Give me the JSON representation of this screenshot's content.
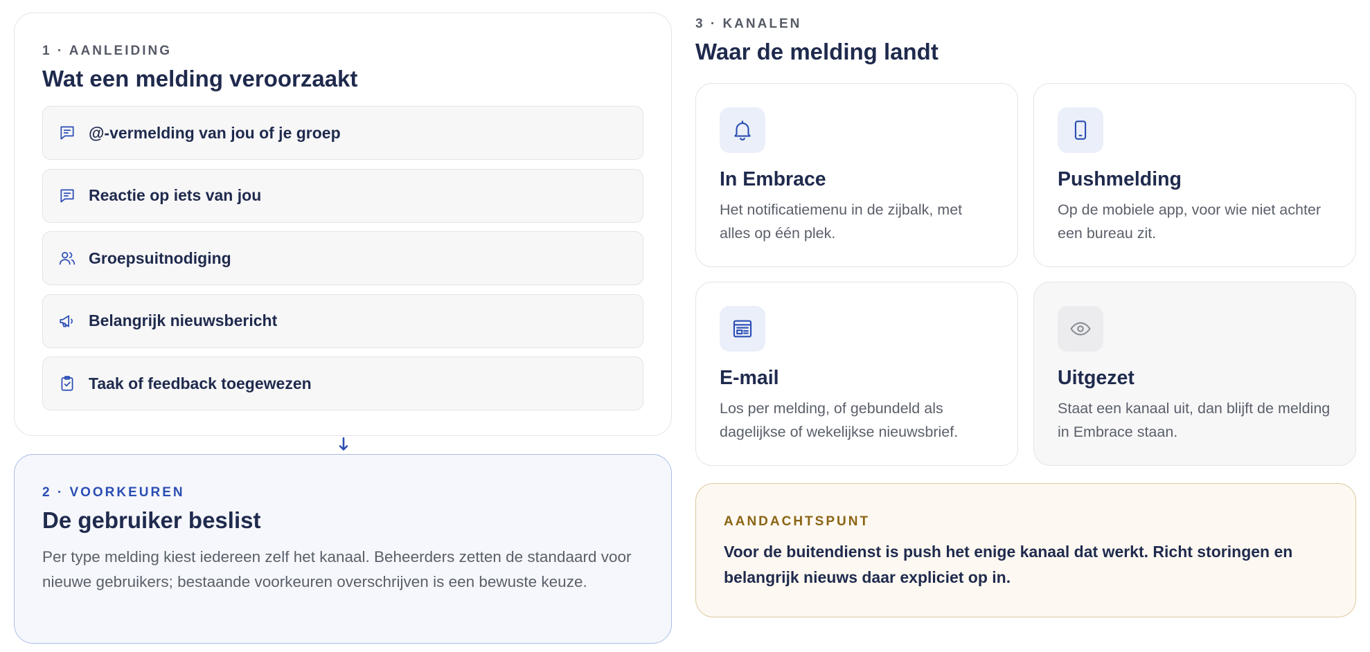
{
  "trigger": {
    "eyebrow": "1 · AANLEIDING",
    "title": "Wat een melding veroorzaakt",
    "items": [
      {
        "label": "@-vermelding van jou of je groep",
        "icon": "chat-icon"
      },
      {
        "label": "Reactie op iets van jou",
        "icon": "chat-icon"
      },
      {
        "label": "Groepsuitnodiging",
        "icon": "users-icon"
      },
      {
        "label": "Belangrijk nieuwsbericht",
        "icon": "megaphone-icon"
      },
      {
        "label": "Taak of feedback toegewezen",
        "icon": "clipboard-check-icon"
      }
    ]
  },
  "preferences": {
    "eyebrow": "2 · VOORKEUREN",
    "title": "De gebruiker beslist",
    "body": "Per type melding kiest iedereen zelf het kanaal. Beheerders zetten de standaard voor nieuwe gebruikers; bestaande voorkeuren overschrijven is een bewuste keuze."
  },
  "channels": {
    "eyebrow": "3 · KANALEN",
    "title": "Waar de melding landt",
    "items": [
      {
        "title": "In Embrace",
        "desc": "Het notificatiemenu in de zijbalk, met alles op één plek.",
        "icon": "bell-icon"
      },
      {
        "title": "Pushmelding",
        "desc": "Op de mobiele app, voor wie niet achter een bureau zit.",
        "icon": "phone-icon"
      },
      {
        "title": "E-mail",
        "desc": "Los per melding, of gebundeld als dagelijkse of wekelijkse nieuwsbrief.",
        "icon": "newsletter-icon"
      },
      {
        "title": "Uitgezet",
        "desc": "Staat een kanaal uit, dan blijft de melding in Embrace staan.",
        "icon": "eye-icon"
      }
    ]
  },
  "callout": {
    "eyebrow": "AANDACHTSPUNT",
    "body": "Voor de buitendienst is push het enige kanaal dat werkt. Richt storingen en belangrijk nieuws daar expliciet op in."
  },
  "colors": {
    "accent": "#2a4db3",
    "text": "#1f2a4d",
    "muted_text": "#5a5f69",
    "callout_accent": "#8a6414"
  }
}
